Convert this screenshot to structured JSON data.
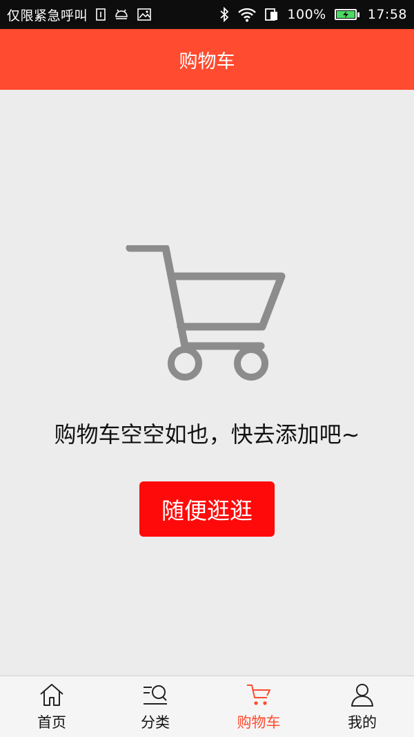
{
  "status_bar": {
    "carrier_text": "仅限紧急呼叫",
    "battery_percent": "100%",
    "time": "17:58",
    "icons": [
      "sim-icon",
      "android-debug-icon",
      "image-icon",
      "bluetooth-icon",
      "wifi-icon",
      "phone-data-icon",
      "battery-icon"
    ]
  },
  "header": {
    "title": "购物车"
  },
  "empty_state": {
    "icon": "shopping-cart-icon",
    "message": "购物车空空如也，快去添加吧~",
    "button_label": "随便逛逛"
  },
  "tabs": [
    {
      "label": "首页",
      "icon": "home-icon",
      "active": false
    },
    {
      "label": "分类",
      "icon": "category-search-icon",
      "active": false
    },
    {
      "label": "购物车",
      "icon": "cart-icon",
      "active": true
    },
    {
      "label": "我的",
      "icon": "user-icon",
      "active": false
    }
  ],
  "colors": {
    "accent": "#ff4b2f",
    "button": "#ff0a0a",
    "background": "#ececec",
    "cart_gray": "#8c8c8c"
  }
}
